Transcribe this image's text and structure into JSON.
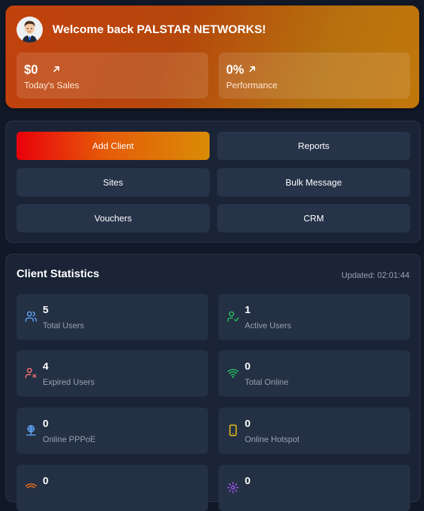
{
  "welcome": {
    "title": "Welcome back PALSTAR NETWORKS!",
    "sales": {
      "value": "$0",
      "label": "Today's Sales"
    },
    "performance": {
      "value": "0%",
      "label": "Performance"
    }
  },
  "actions": [
    {
      "label": "Add Client"
    },
    {
      "label": "Reports"
    },
    {
      "label": "Sites"
    },
    {
      "label": "Bulk Message"
    },
    {
      "label": "Vouchers"
    },
    {
      "label": "CRM"
    }
  ],
  "stats": {
    "title": "Client Statistics",
    "updated": "Updated: 02:01:44",
    "cards": [
      {
        "value": "5",
        "label": "Total Users",
        "icon": "users-icon",
        "color": "#60a5fa"
      },
      {
        "value": "1",
        "label": "Active Users",
        "icon": "user-check-icon",
        "color": "#22c55e"
      },
      {
        "value": "4",
        "label": "Expired Users",
        "icon": "user-x-icon",
        "color": "#f87171"
      },
      {
        "value": "0",
        "label": "Total Online",
        "icon": "wifi-icon",
        "color": "#22c55e"
      },
      {
        "value": "0",
        "label": "Online PPPoE",
        "icon": "network-icon",
        "color": "#60a5fa"
      },
      {
        "value": "0",
        "label": "Online Hotspot",
        "icon": "phone-icon",
        "color": "#facc15"
      },
      {
        "value": "0",
        "label": "",
        "icon": "signal-icon",
        "color": "#f97316"
      },
      {
        "value": "0",
        "label": "",
        "icon": "gear-icon",
        "color": "#a855f7"
      }
    ]
  }
}
